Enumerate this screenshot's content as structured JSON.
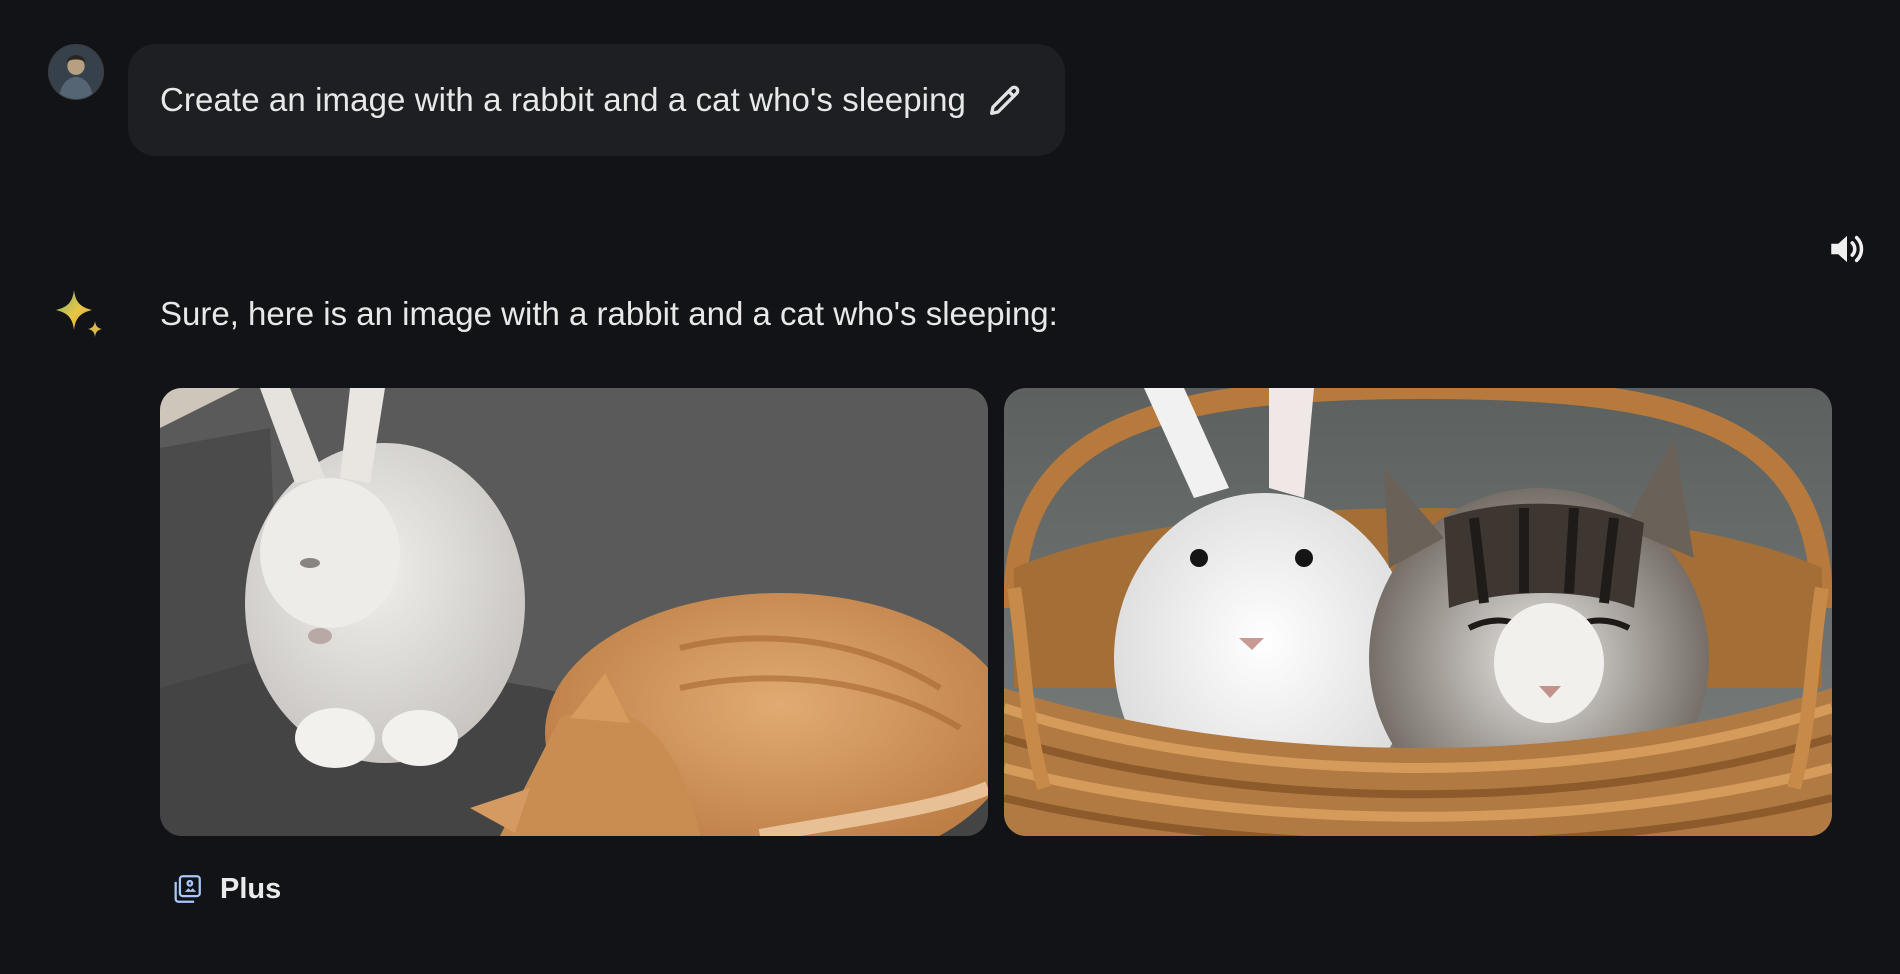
{
  "user_prompt": {
    "text": "Create an image with a rabbit and a cat who's sleeping",
    "edit_icon": "pencil-icon",
    "avatar_icon": "user-avatar"
  },
  "response": {
    "assistant_icon": "sparkle-icon",
    "text": "Sure, here is an image with a rabbit and a cat who's sleeping:",
    "speaker_icon": "volume-icon",
    "images": [
      {
        "name": "generated-image-1"
      },
      {
        "name": "generated-image-2"
      }
    ],
    "action": {
      "icon": "image-stack-icon",
      "label": "Plus"
    }
  },
  "colors": {
    "background": "#121316",
    "bubble": "#1e1f22",
    "text": "#e8e8e8"
  }
}
